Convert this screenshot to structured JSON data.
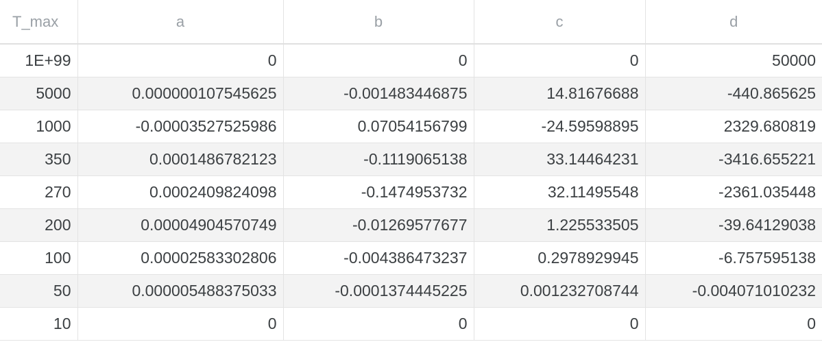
{
  "table": {
    "columns": [
      "T_max",
      "a",
      "b",
      "c",
      "d"
    ],
    "rows": [
      [
        "1E+99",
        "0",
        "0",
        "0",
        "50000"
      ],
      [
        "5000",
        "0.000000107545625",
        "-0.001483446875",
        "14.81676688",
        "-440.865625"
      ],
      [
        "1000",
        "-0.00003527525986",
        "0.07054156799",
        "-24.59598895",
        "2329.680819"
      ],
      [
        "350",
        "0.0001486782123",
        "-0.1119065138",
        "33.14464231",
        "-3416.655221"
      ],
      [
        "270",
        "0.0002409824098",
        "-0.1474953732",
        "32.11495548",
        "-2361.035448"
      ],
      [
        "200",
        "0.00004904570749",
        "-0.01269577677",
        "1.225533505",
        "-39.64129038"
      ],
      [
        "100",
        "0.00002583302806",
        "-0.004386473237",
        "0.2978929945",
        "-6.757595138"
      ],
      [
        "50",
        "0.000005488375033",
        "-0.0001374445225",
        "0.001232708744",
        "-0.004071010232"
      ],
      [
        "10",
        "0",
        "0",
        "0",
        "0"
      ]
    ]
  },
  "colors": {
    "header_text": "#9aa0a6",
    "cell_text": "#3c4043",
    "zebra": "#f3f3f3",
    "grid": "#e3e3e3"
  }
}
